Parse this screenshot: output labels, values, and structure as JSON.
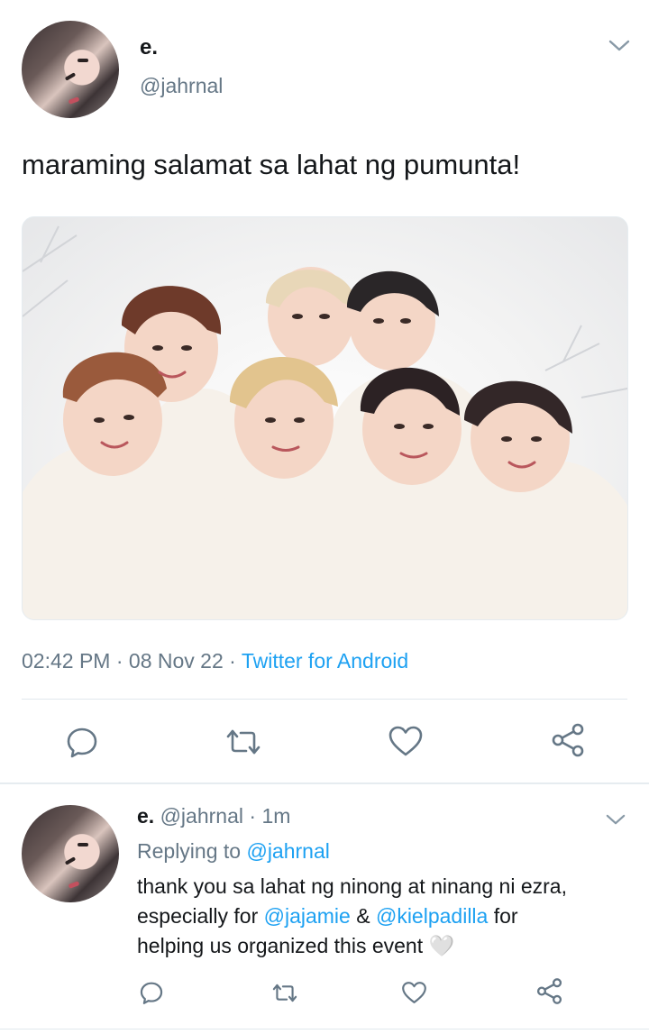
{
  "main_tweet": {
    "display_name": "e.",
    "handle": "@jahrnal",
    "text": "maraming salamat sa lahat ng pumunta!",
    "time": "02:42 PM",
    "date": "08 Nov 22",
    "separator": "·",
    "source": "Twitter for Android"
  },
  "reply_tweet": {
    "display_name": "e.",
    "handle": "@jahrnal",
    "separator": "·",
    "age": "1m",
    "replying_prefix": "Replying to ",
    "replying_to": "@jahrnal",
    "line1": "thank you sa lahat ng ninong at ninang ni ezra,",
    "line2_a": "especially for ",
    "mention1": "@jajamie",
    "line2_b": " & ",
    "mention2": "@kielpadilla",
    "line2_c": " for",
    "line3": "helping us organized this event",
    "emoji": "🤍"
  },
  "icons": {
    "reply": "reply-icon",
    "retweet": "retweet-icon",
    "like": "heart-icon",
    "share": "share-icon",
    "more": "chevron-down-icon"
  },
  "colors": {
    "accent": "#1da1f2",
    "secondary_text": "#657786",
    "primary_text": "#14171a"
  }
}
